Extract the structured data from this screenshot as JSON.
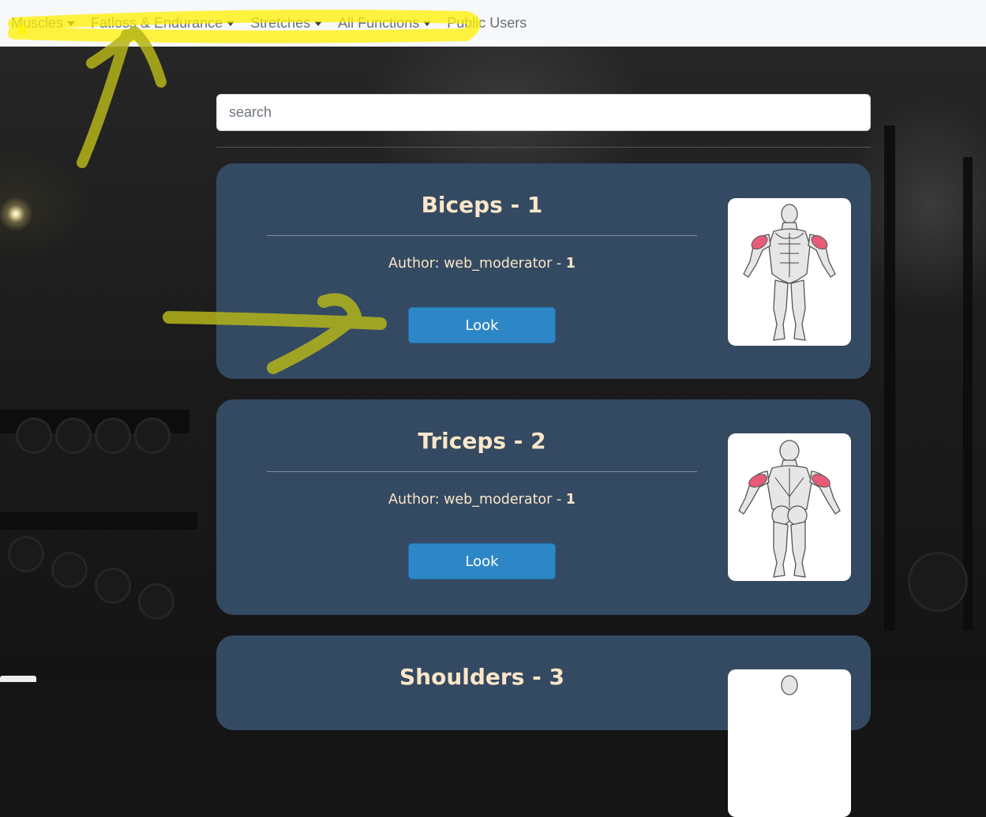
{
  "nav": {
    "items": [
      {
        "label": "Muscles",
        "dropdown": true
      },
      {
        "label": "Fatloss & Endurance",
        "dropdown": true
      },
      {
        "label": "Stretches",
        "dropdown": true
      },
      {
        "label": "All Functions",
        "dropdown": true
      },
      {
        "label": "Public Users",
        "dropdown": false
      }
    ]
  },
  "search": {
    "placeholder": "search",
    "value": ""
  },
  "cards": [
    {
      "title": "Biceps - 1",
      "author_prefix": "Author: web_moderator - ",
      "author_id": "1",
      "button": "Look",
      "image_icon": "biceps-muscle-diagram-icon"
    },
    {
      "title": "Triceps - 2",
      "author_prefix": "Author: web_moderator - ",
      "author_id": "1",
      "button": "Look",
      "image_icon": "triceps-muscle-diagram-icon"
    },
    {
      "title": "Shoulders - 3",
      "image_icon": "shoulders-muscle-diagram-icon"
    }
  ],
  "colors": {
    "navbar_bg": "#f7f8fa",
    "card_bg": "#344a62",
    "card_text": "#fbe6c9",
    "button_bg": "#2d87c7",
    "highlight": "#fff200",
    "highlighted_muscle": "#e85b78"
  }
}
